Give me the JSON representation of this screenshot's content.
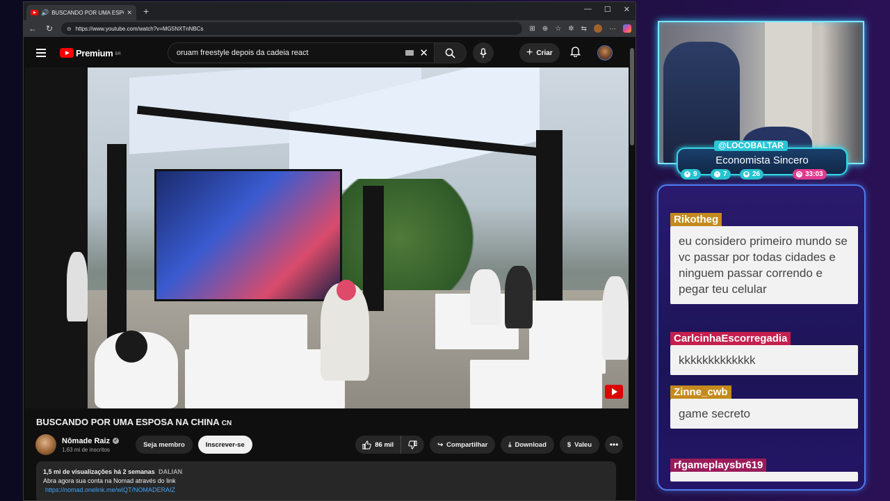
{
  "browser": {
    "tab_title": "BUSCANDO POR UMA ESPO",
    "url": "https://www.youtube.com/watch?v=MG5NXTnNBCs"
  },
  "youtube": {
    "logo_text": "Premium",
    "country": "BR",
    "search_query": "oruam freestyle depois da cadeia react",
    "create_label": "Criar"
  },
  "video": {
    "title": "BUSCANDO POR UMA ESPOSA NA CHINA",
    "title_suffix": "CN",
    "channel_name": "Nômade Raiz",
    "subscribers": "1,63 mi de inscritos",
    "join_label": "Seja membro",
    "subscribe_label": "Inscrever-se",
    "likes": "86 mil",
    "share_label": "Compartilhar",
    "download_label": "Download",
    "thanks_label": "Valeu",
    "description": {
      "views": "1,5 mi de visualizações",
      "date": "há 2 semanas",
      "location": "DALIAN",
      "line1": "Abra agora sua conta na Nomad através do link",
      "link": "https://nomad.onelink.me/wIQT/NOMADERAIZ"
    }
  },
  "overlay": {
    "handle": "@LOCOBALTAR",
    "stream_title": "Economista Sincero",
    "stats": [
      "9",
      "7",
      "26"
    ],
    "timer": "33:03"
  },
  "chat": [
    {
      "user": "Rikotheg",
      "message": "eu considero primeiro mundo se vc passar por todas cidades e ninguem passar correndo e pegar teu celular"
    },
    {
      "user": "CarlcinhaEscorregadia",
      "message": "kkkkkkkkkkkkk"
    },
    {
      "user": "Zinne_cwb",
      "message": "game secreto"
    },
    {
      "user": "rfgameplaysbr619",
      "message": ""
    }
  ],
  "colors": {
    "youtube_red": "#ff0000",
    "overlay_cyan": "#35d7e8",
    "timer_pink": "#e23a8f",
    "chat_gold": "#c48a1d",
    "chat_red": "#c41f4e"
  }
}
